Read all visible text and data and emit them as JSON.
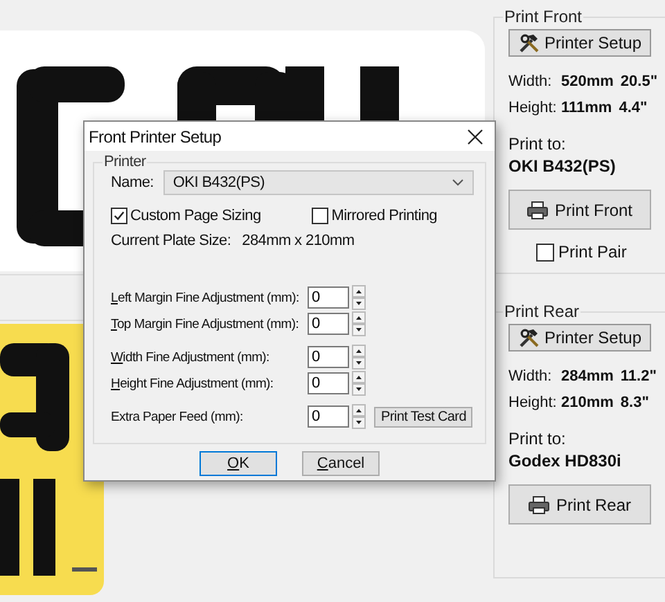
{
  "panels": [
    {
      "title": "Print Front",
      "setup_button": "Printer Setup",
      "width_label": "Width:",
      "width_mm": "520mm",
      "width_in": "20.5\"",
      "height_label": "Height:",
      "height_mm": "111mm",
      "height_in": "4.4\"",
      "print_to_label": "Print to:",
      "printer": "OKI B432(PS)",
      "print_button": "Print Front",
      "pair": {
        "label": "Print Pair",
        "checked": false
      }
    },
    {
      "title": "Print Rear",
      "setup_button": "Printer Setup",
      "width_label": "Width:",
      "width_mm": "284mm",
      "width_in": "11.2\"",
      "height_label": "Height:",
      "height_mm": "210mm",
      "height_in": "8.3\"",
      "print_to_label": "Print to:",
      "printer": "Godex HD830i",
      "print_button": "Print Rear"
    }
  ],
  "dialog": {
    "title": "Front Printer Setup",
    "group": "Printer",
    "name_label": "Name:",
    "printer": "OKI B432(PS)",
    "checkboxes": [
      {
        "label": "Custom Page Sizing",
        "checked": true
      },
      {
        "label": "Mirrored Printing",
        "checked": false
      }
    ],
    "plate_size_label": "Current Plate Size:",
    "plate_size": "284mm x 210mm",
    "fields": [
      {
        "label": "Left Margin Fine Adjustment (mm):",
        "value": "0",
        "access_key": true
      },
      {
        "label": "Top Margin Fine Adjustment (mm):",
        "value": "0",
        "access_key": true
      },
      {
        "label": "Width Fine Adjustment (mm):",
        "value": "0",
        "access_key": true
      },
      {
        "label": "Height Fine Adjustment (mm):",
        "value": "0",
        "access_key": true
      },
      {
        "label": "Extra Paper Feed (mm):",
        "value": "0",
        "access_key": false
      }
    ],
    "test_button": "Print Test Card",
    "ok_button": "OK",
    "cancel_button": "Cancel"
  }
}
